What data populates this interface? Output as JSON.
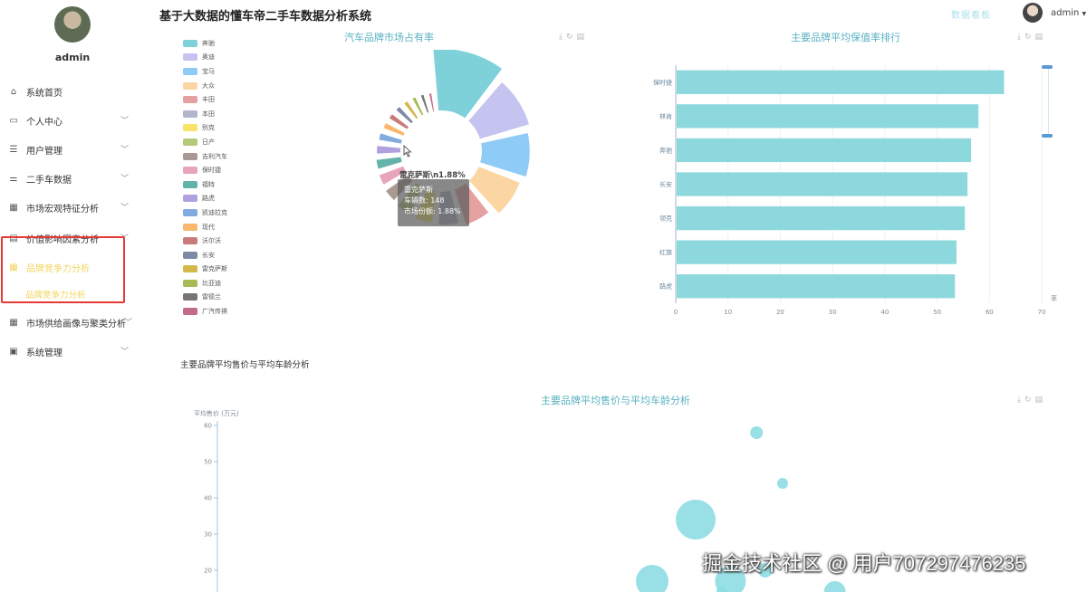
{
  "header": {
    "title": "基于大数据的懂车帝二手车数据分析系统",
    "big_screen_label": "数据看板",
    "user": "admin"
  },
  "sidebar": {
    "username": "admin",
    "items": [
      {
        "label": "系统首页",
        "icon": "home-icon"
      },
      {
        "label": "个人中心",
        "icon": "monitor-icon"
      },
      {
        "label": "用户管理",
        "icon": "menu-icon"
      },
      {
        "label": "二手车数据",
        "icon": "sliders-icon"
      },
      {
        "label": "市场宏观特征分析",
        "icon": "grid-icon"
      },
      {
        "label": "价值影响因素分析",
        "icon": "clipboard-icon"
      },
      {
        "label": "品牌竞争力分析",
        "icon": "grid-icon"
      },
      {
        "label": "市场供给画像与聚类分析",
        "icon": "grid-icon"
      },
      {
        "label": "系统管理",
        "icon": "clipboard-check-icon"
      }
    ],
    "active_submenu": "品牌竞争力分析"
  },
  "pie_chart": {
    "title": "汽车品牌市场占有率",
    "hover_label": "雷克萨斯\\n1.88%",
    "tooltip": {
      "name": "雷克萨斯",
      "line1": "车辆数: 148",
      "line2": "市场份额: 1.88%"
    }
  },
  "bar_chart": {
    "title": "主要品牌平均保值率排行",
    "unit_label": "率"
  },
  "bubble_section": {
    "label": "主要品牌平均售价与平均车龄分析",
    "title": "主要品牌平均售价与平均车龄分析",
    "y_axis_label": "平均售价 (万元)"
  },
  "watermark": "掘金技术社区 @ 用户707297476235",
  "chart_data": [
    {
      "type": "pie",
      "rose": true,
      "categories": [
        "奔驰",
        "奥迪",
        "宝马",
        "大众",
        "丰田",
        "本田",
        "别克",
        "日产",
        "吉利汽车",
        "保时捷",
        "福特",
        "路虎",
        "凯迪拉克",
        "现代",
        "沃尔沃",
        "长安",
        "雷克萨斯",
        "比亚迪",
        "雷德兰",
        "广汽传祺"
      ],
      "values": [
        9.5,
        7.6,
        7.0,
        6.3,
        5.0,
        4.3,
        4.0,
        3.6,
        3.3,
        3.0,
        2.8,
        2.6,
        2.4,
        2.2,
        2.1,
        2.0,
        1.88,
        1.8,
        1.7,
        1.6
      ],
      "colors": [
        "#7fd1d9",
        "#c5c3ef",
        "#8ecbf6",
        "#fbd5a2",
        "#e5a1a1",
        "#b1b6cc",
        "#f7e46a",
        "#b5c97b",
        "#a89a92",
        "#e8a3bd",
        "#63b3aa",
        "#b0a0e0",
        "#82aade",
        "#f8b86e",
        "#c77b7b",
        "#7e89a6",
        "#d4b84b",
        "#a6bb55",
        "#7a7373",
        "#c26b8d"
      ],
      "tooltip": {
        "name": "雷克萨斯",
        "count": 148,
        "share": "1.88%"
      }
    },
    {
      "type": "bar",
      "orientation": "horizontal",
      "categories": [
        "保时捷",
        "林肯",
        "奔驰",
        "长安",
        "领克",
        "红旗",
        "路虎"
      ],
      "values": [
        62.8,
        57.9,
        56.5,
        55.8,
        55.3,
        53.7,
        53.4
      ],
      "xlim": [
        0,
        70
      ],
      "xticks": [
        0,
        10,
        20,
        30,
        40,
        50,
        60,
        70
      ],
      "color": "#8dd8dc"
    },
    {
      "type": "scatter",
      "bubble": true,
      "ylabel": "平均售价 (万元)",
      "yticks": [
        20,
        30,
        40,
        50,
        60
      ],
      "ylim": [
        15,
        60
      ],
      "points": [
        {
          "x": 0.62,
          "y": 58,
          "r": 7
        },
        {
          "x": 0.65,
          "y": 44,
          "r": 6
        },
        {
          "x": 0.55,
          "y": 34,
          "r": 22
        },
        {
          "x": 0.5,
          "y": 17,
          "r": 18
        },
        {
          "x": 0.59,
          "y": 17,
          "r": 17
        },
        {
          "x": 0.63,
          "y": 20,
          "r": 8
        },
        {
          "x": 0.71,
          "y": 14,
          "r": 12
        },
        {
          "x": 0.58,
          "y": 14,
          "r": 6
        }
      ],
      "color": "#8ddde3"
    }
  ]
}
